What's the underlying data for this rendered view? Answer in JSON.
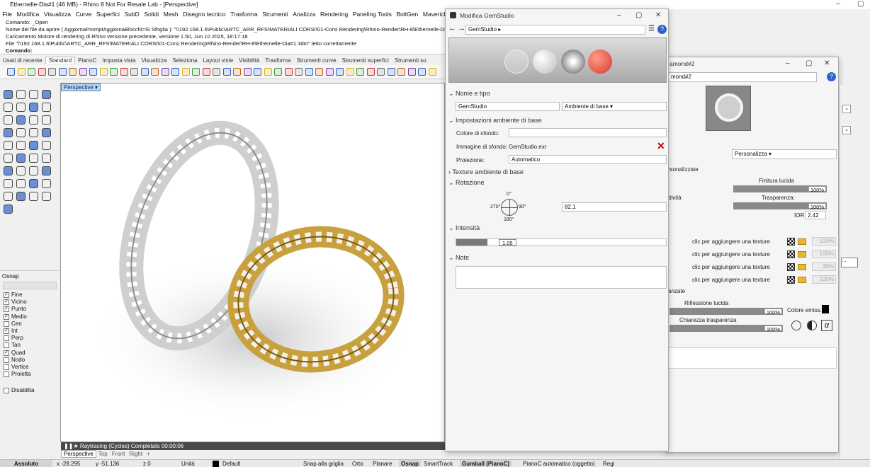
{
  "window": {
    "title": "Ethernelle-Dia#1 (46 MB) - Rhino 8 Not For Resale Lab - [Perspective]"
  },
  "menu": [
    "File",
    "Modifica",
    "Visualizza",
    "Curve",
    "Superfici",
    "SubD",
    "Solidi",
    "Mesh",
    "Disegno tecnico",
    "Trasforma",
    "Strumenti",
    "Analizza",
    "Rendering",
    "Paneling Tools",
    "BoltGen",
    "Maverick",
    "Lan"
  ],
  "command_history": [
    "Comando: _Open",
    "Nome del file da aprire ( AggiornaPromptAggiornaBlocchi=Si  Sfoglia ): \"\\\\192.168.1.6\\Public\\ARTC_ARR_RFS\\MATERIALI CORSI\\01-Corsi Rendering\\Rhino-Render\\RH-8\\Ethernelle-Di",
    "Caricamento Motore di rendering di Rhino versione precedente, versione 1.50, Jun 10 2025, 18:17:18",
    "File \"\\\\192.168.1.6\\Public\\ARTC_ARR_RFS\\MATERIALI CORSI\\01-Corsi Rendering\\Rhino-Render\\RH-8\\Ethernelle-Dia#1.3dm\" letto correttamente"
  ],
  "command_prompt": "Comando:",
  "toolbar_tabs": [
    "Usati di recente",
    "Standard",
    "PianoC",
    "Imposta vista",
    "Visualizza",
    "Seleziona",
    "Layout viste",
    "Visibilità",
    "Trasforma",
    "Strumenti curve",
    "Strumenti superfici",
    "Strumenti so"
  ],
  "active_tab": "Standard",
  "viewport": {
    "label": "Perspective",
    "status": "Raytracing (Cycles)   Completato   00:00:06",
    "tabs": [
      "Perspective",
      "Top",
      "Front",
      "Right"
    ]
  },
  "osnap": {
    "title": "Osnap",
    "items": [
      {
        "label": "Fine",
        "checked": true
      },
      {
        "label": "Vicino",
        "checked": true
      },
      {
        "label": "Punto",
        "checked": true
      },
      {
        "label": "Medio",
        "checked": true
      },
      {
        "label": "Cen",
        "checked": false
      },
      {
        "label": "Int",
        "checked": true
      },
      {
        "label": "Perp",
        "checked": false
      },
      {
        "label": "Tan",
        "checked": false
      },
      {
        "label": "Quad",
        "checked": true
      },
      {
        "label": "Nodo",
        "checked": false
      },
      {
        "label": "Vertice",
        "checked": false
      },
      {
        "label": "Proietta",
        "checked": false
      }
    ],
    "disable": "Disabilita"
  },
  "status": {
    "absolute": "Assoluto",
    "x": "x -28.295",
    "y": "y -51.136",
    "z": "z 0",
    "units": "Unità",
    "layer": "Default",
    "snaps": [
      "Snap alla griglia",
      "Orto",
      "Planare",
      "Osnap",
      "SmartTrack",
      "Gumball (PianoC)",
      "PianoC automatico (oggetto)",
      "Regi"
    ]
  },
  "gem_dialog": {
    "title": "Modifica GemStudio",
    "breadcrumb": "GemStudio",
    "section_name": "Nome e tipo",
    "name": "GemStudio",
    "type": "Ambiente di base",
    "section_base": "Impostazioni ambiente di base",
    "bg_color_label": "Colore di sfondo:",
    "bg_image_label": "Immagine di sfondo:",
    "bg_image": "GemStudio.exr",
    "projection_label": "Proiezione:",
    "projection": "Automatico",
    "section_textures": "Texture ambiente di base",
    "section_rotation": "Rotazione",
    "compass": {
      "top": "0°",
      "left": "270°",
      "right": "90°",
      "bottom": "180°"
    },
    "rotation": "82.1",
    "section_intensity": "Intensità",
    "intensity": "1.05",
    "intensity_fraction": 0.15,
    "section_notes": "Note"
  },
  "diamond_panel": {
    "title": "amond#2",
    "name": "mond#2",
    "preset": "Personalizza",
    "section": "rsonalizzate",
    "glossy_label": "Finitura lucida",
    "glossy": "100%",
    "transp_label": "Trasparenza:",
    "transp": "100%",
    "ior_label": "IOR:",
    "ior": "2.42",
    "attivita": "ttività",
    "texture_hint": "clic per aggiungere una texture",
    "tex_values": [
      "100%",
      "100%",
      "30%",
      "100%"
    ],
    "section_adv": "anzate",
    "refl_label": "Riflessione lucida",
    "refl": "100%",
    "emis_label": "Colore emiss.",
    "clarity_label": "Chiarezza trasparenza",
    "clarity": "100%"
  }
}
